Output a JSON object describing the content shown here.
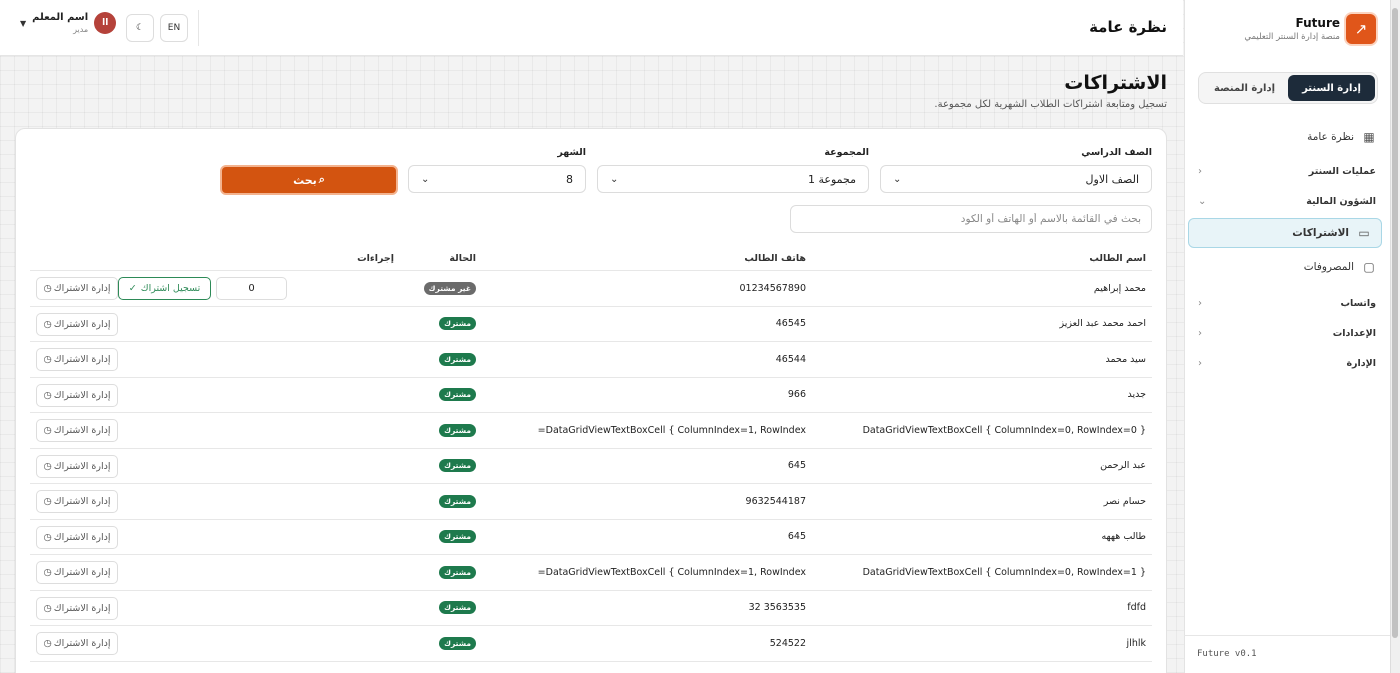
{
  "brand": {
    "name": "Future",
    "subtitle": "منصة إدارة السنتر التعليمي"
  },
  "sidebar": {
    "tabs": [
      {
        "label": "إدارة المنصة",
        "active": false
      },
      {
        "label": "إدارة السنتر",
        "active": true
      }
    ],
    "overview": "نظرة عامة",
    "center_ops": "عمليات السنتر",
    "finance": "الشؤون المالية",
    "subscriptions": "الاشتراكات",
    "expenses": "المصروفات",
    "whatsapp": "واتساب",
    "settings": "الإعدادات",
    "admin": "الإدارة",
    "version": "Future v0.1"
  },
  "topbar": {
    "title": "نظرة عامة",
    "lang": "EN",
    "user_name": "اسم المعلم",
    "user_role": "مدير",
    "avatar": "اا"
  },
  "page": {
    "title": "الاشتراكات",
    "subtitle": "تسجيل ومتابعة اشتراكات الطلاب الشهرية لكل مجموعة."
  },
  "filters": {
    "grade_label": "الصف الدراسي",
    "grade_value": "الصف الاول",
    "group_label": "المجموعة",
    "group_value": "مجموعة 1",
    "month_label": "الشهر",
    "month_value": "8",
    "search_button": "بحث",
    "search_placeholder": "بحث في القائمة بالاسم أو الهاتف أو الكود"
  },
  "table": {
    "headers": {
      "name": "اسم الطالب",
      "phone": "هاتف الطالب",
      "status": "الحالة",
      "actions": "إجراءات"
    },
    "manage_label": "إدارة الاشتراك",
    "register_label": "تسجيل اشتراك",
    "rows": [
      {
        "name": "محمد إبراهيم",
        "phone": "01234567890",
        "status": "غير مشترك",
        "subscribed": false,
        "qty": "0"
      },
      {
        "name": "احمد محمد عبد العزيز",
        "phone": "46545",
        "status": "مشترك",
        "subscribed": true
      },
      {
        "name": "سيد محمد",
        "phone": "46544",
        "status": "مشترك",
        "subscribed": true
      },
      {
        "name": "جديد",
        "phone": "966",
        "status": "مشترك",
        "subscribed": true
      },
      {
        "name": "DataGridViewTextBoxCell { ColumnIndex=0, RowIndex=0 }",
        "phone": "DataGridViewTextBoxCell { ColumnIndex=1, RowIndex=",
        "status": "مشترك",
        "subscribed": true
      },
      {
        "name": "عبد الرحمن",
        "phone": "645",
        "status": "مشترك",
        "subscribed": true
      },
      {
        "name": "حسام نصر",
        "phone": "9632544187",
        "status": "مشترك",
        "subscribed": true
      },
      {
        "name": "طالب هههه",
        "phone": "645",
        "status": "مشترك",
        "subscribed": true
      },
      {
        "name": "DataGridViewTextBoxCell { ColumnIndex=0, RowIndex=1 }",
        "phone": "DataGridViewTextBoxCell { ColumnIndex=1, RowIndex=",
        "status": "مشترك",
        "subscribed": true
      },
      {
        "name": "fdfd",
        "phone": "3563535 32",
        "status": "مشترك",
        "subscribed": true
      },
      {
        "name": "jlhlk",
        "phone": "524522",
        "status": "مشترك",
        "subscribed": true
      }
    ]
  },
  "colors": {
    "accent": "#d35410",
    "dark": "#1d2b3a",
    "success": "#1e7a4d"
  }
}
